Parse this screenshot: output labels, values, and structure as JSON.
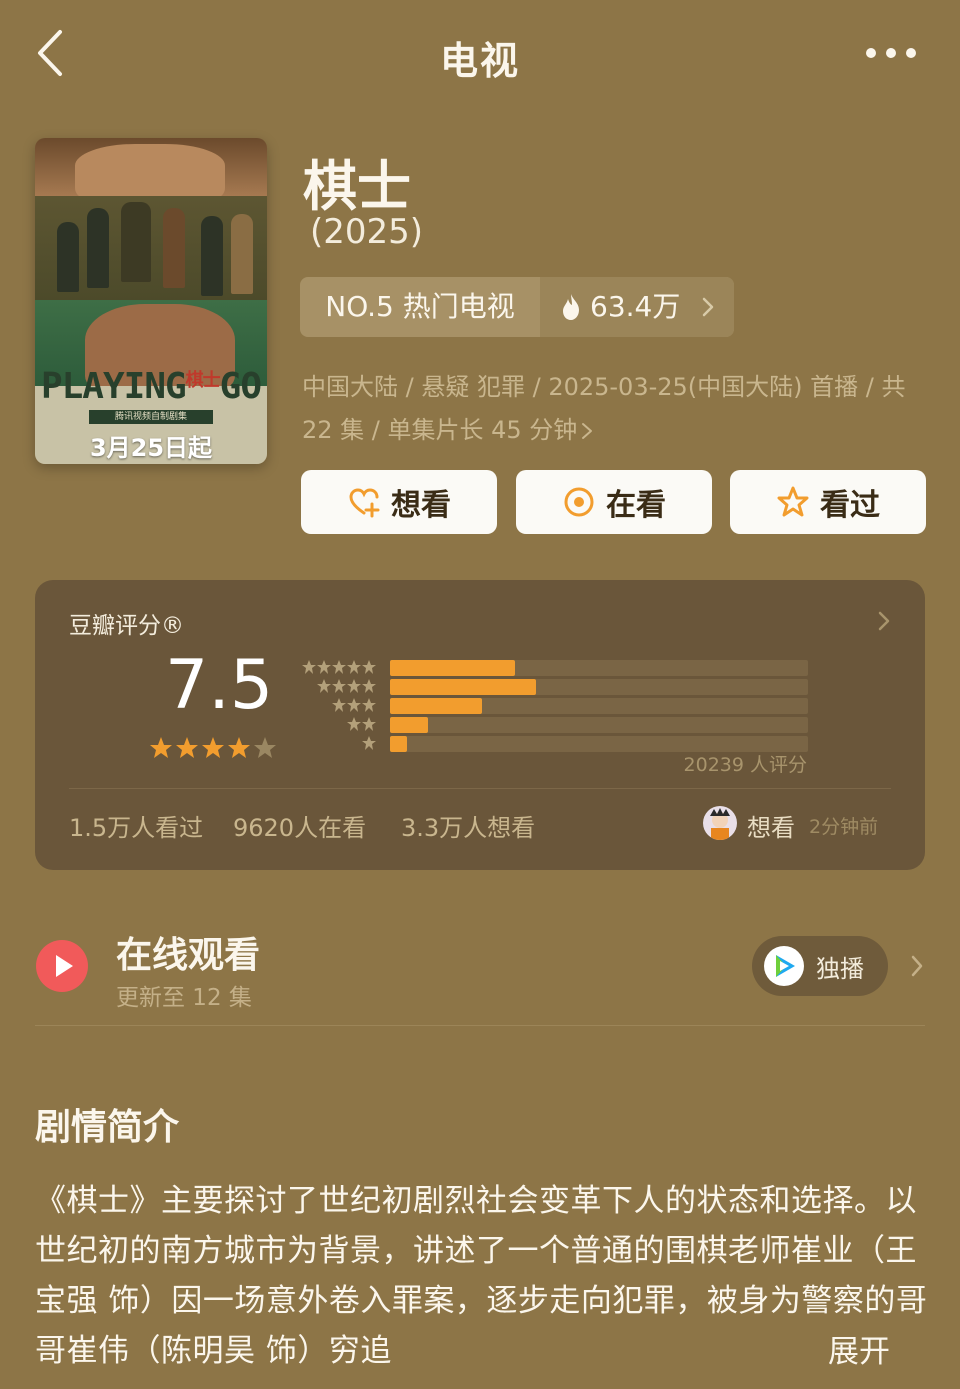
{
  "header": {
    "title": "电视"
  },
  "poster": {
    "title_en_part1": "PLAYING",
    "title_en_part2": "GO",
    "title_cn_mark": "棋士",
    "subtitle": "腾讯视频自制剧集",
    "date": "3月25日起"
  },
  "show": {
    "title": "棋士",
    "year": "(2025)",
    "rank": "NO.5 热门电视",
    "heat": "63.4万",
    "meta": "中国大陆 / 悬疑 犯罪 / 2025-03-25(中国大陆) 首播 / 共 22 集 / 单集片长 45 分钟"
  },
  "actions": {
    "want": "想看",
    "watching": "在看",
    "watched": "看过"
  },
  "rating": {
    "label": "豆瓣评分®",
    "score": "7.5",
    "stars": 4,
    "distribution": [
      {
        "stars": 5,
        "fraction": 0.3
      },
      {
        "stars": 4,
        "fraction": 0.35
      },
      {
        "stars": 3,
        "fraction": 0.22
      },
      {
        "stars": 2,
        "fraction": 0.09
      },
      {
        "stars": 1,
        "fraction": 0.04
      }
    ],
    "count": "20239 人评分",
    "watched": "1.5万人看过",
    "watching": "9620人在看",
    "want": "3.3万人想看",
    "recent_action": "想看",
    "recent_time": "2分钟前"
  },
  "watch": {
    "title": "在线观看",
    "subtitle": "更新至 12 集",
    "exclusive": "独播"
  },
  "synopsis": {
    "title": "剧情简介",
    "body": "《棋士》主要探讨了世纪初剧烈社会变革下人的状态和选择。以世纪初的南方城市为背景，讲述了一个普通的围棋老师崔业（王宝强 饰）因一场意外卷入罪案，逐步走向犯罪，被身为警察的哥哥崔伟（陈明昊 饰）穷追",
    "expand": "展开"
  },
  "colors": {
    "background": "#8d7547",
    "card": "#6a563a",
    "accent": "#f29d2e",
    "play": "#f15a5a"
  }
}
